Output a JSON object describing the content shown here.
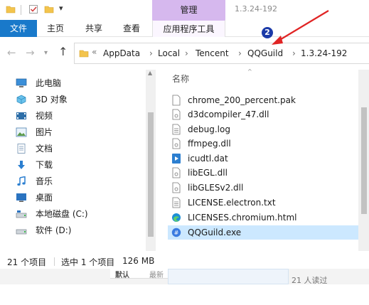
{
  "window": {
    "context_tab": "管理",
    "title": "1.3.24-192"
  },
  "ribbon": {
    "file": "文件",
    "home": "主页",
    "share": "共享",
    "view": "查看",
    "app_tools": "应用程序工具"
  },
  "address": {
    "overflow": "«",
    "crumbs": [
      "AppData",
      "Local",
      "Tencent",
      "QQGuild",
      "1.3.24-192"
    ],
    "separator": "›"
  },
  "annotation": {
    "badge": "2",
    "color": "#e02424"
  },
  "sidebar": {
    "items": [
      {
        "label": "此电脑",
        "icon": "computer-icon"
      },
      {
        "label": "3D 对象",
        "icon": "3d-objects-icon"
      },
      {
        "label": "视频",
        "icon": "video-icon"
      },
      {
        "label": "图片",
        "icon": "pictures-icon"
      },
      {
        "label": "文档",
        "icon": "documents-icon"
      },
      {
        "label": "下载",
        "icon": "download-icon"
      },
      {
        "label": "音乐",
        "icon": "music-icon"
      },
      {
        "label": "桌面",
        "icon": "desktop-icon"
      },
      {
        "label": "本地磁盘 (C:)",
        "icon": "drive-c-icon"
      },
      {
        "label": "软件 (D:)",
        "icon": "drive-d-icon"
      }
    ]
  },
  "files": {
    "column_name": "名称",
    "items": [
      {
        "name": "chrome_200_percent.pak",
        "icon": "file-icon"
      },
      {
        "name": "d3dcompiler_47.dll",
        "icon": "dll-icon"
      },
      {
        "name": "debug.log",
        "icon": "text-file-icon"
      },
      {
        "name": "ffmpeg.dll",
        "icon": "dll-icon"
      },
      {
        "name": "icudtl.dat",
        "icon": "media-file-icon"
      },
      {
        "name": "libEGL.dll",
        "icon": "dll-icon"
      },
      {
        "name": "libGLESv2.dll",
        "icon": "dll-icon"
      },
      {
        "name": "LICENSE.electron.txt",
        "icon": "text-file-icon"
      },
      {
        "name": "LICENSES.chromium.html",
        "icon": "edge-icon"
      },
      {
        "name": "QQGuild.exe",
        "icon": "qqguild-icon",
        "selected": true
      }
    ]
  },
  "status": {
    "count": "21 个项目",
    "selected": "选中 1 个项目",
    "size": "126 MB"
  },
  "background_page": {
    "tab_active": "默认",
    "tab_other": "最新",
    "reads": "21 人读过"
  },
  "colors": {
    "file_tab": "#1979ca",
    "context_tab": "#d6b8ee",
    "selection": "#cce8ff",
    "badge": "#1b3aa8"
  }
}
